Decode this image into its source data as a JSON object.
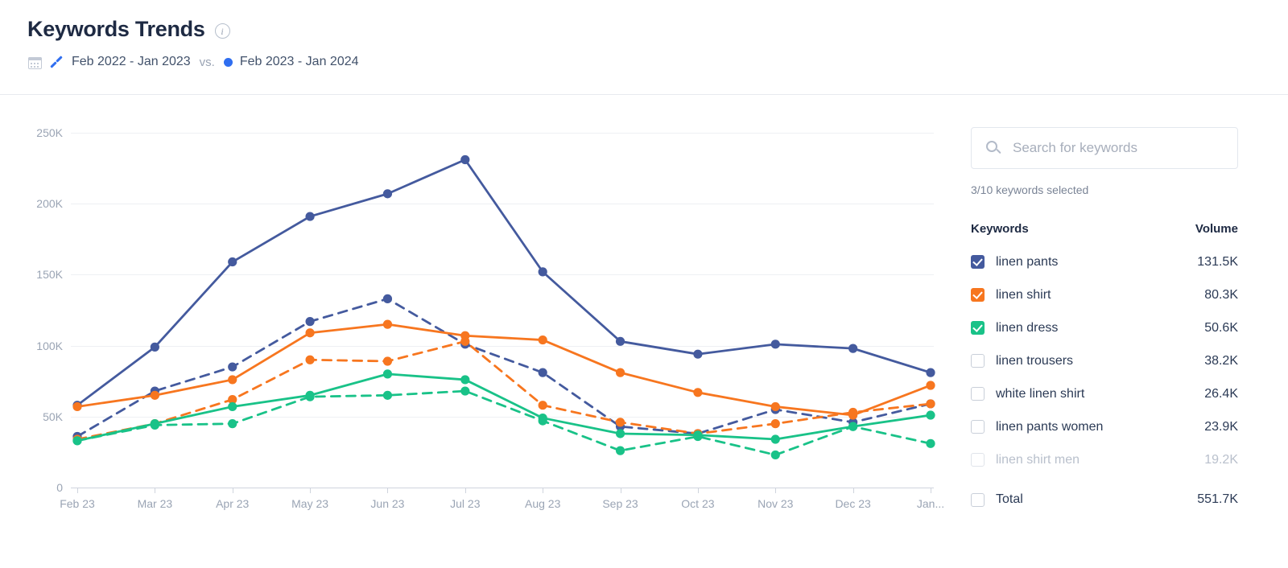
{
  "header": {
    "title": "Keywords Trends",
    "info_icon": "info-icon",
    "calendar_icon": "calendar-icon",
    "previous_range": "Feb 2022 - Jan 2023",
    "vs_label": "vs.",
    "current_range": "Feb 2023 - Jan 2024",
    "previous_marker_color": "#2f6ef0",
    "current_marker_color": "#2f6ef0"
  },
  "sidebar": {
    "search": {
      "placeholder": "Search for keywords",
      "value": "",
      "icon": "search-icon"
    },
    "selected_count": "3/10 keywords selected",
    "columns": {
      "keywords": "Keywords",
      "volume": "Volume"
    },
    "rows": [
      {
        "label": "linen pants",
        "volume": "131.5K",
        "checked": true,
        "color": "#445a9e",
        "disabled": false
      },
      {
        "label": "linen shirt",
        "volume": "80.3K",
        "checked": true,
        "color": "#f7761f",
        "disabled": false
      },
      {
        "label": "linen dress",
        "volume": "50.6K",
        "checked": true,
        "color": "#19c288",
        "disabled": false
      },
      {
        "label": "linen trousers",
        "volume": "38.2K",
        "checked": false,
        "color": "#c9cfd9",
        "disabled": false
      },
      {
        "label": "white linen shirt",
        "volume": "26.4K",
        "checked": false,
        "color": "#c9cfd9",
        "disabled": false
      },
      {
        "label": "linen pants women",
        "volume": "23.9K",
        "checked": false,
        "color": "#c9cfd9",
        "disabled": false
      },
      {
        "label": "linen shirt men",
        "volume": "19.2K",
        "checked": false,
        "color": "#c9cfd9",
        "disabled": true
      }
    ],
    "total": {
      "label": "Total",
      "volume": "551.7K",
      "checked": false
    }
  },
  "chart_data": {
    "type": "line",
    "title": "Keywords Trends",
    "xlabel": "",
    "ylabel": "",
    "ylim": [
      0,
      250000
    ],
    "yticks": [
      0,
      50000,
      100000,
      150000,
      200000,
      250000
    ],
    "ytick_labels": [
      "0",
      "50K",
      "100K",
      "150K",
      "200K",
      "250K"
    ],
    "grid": true,
    "legend_position": "right-panel",
    "categories": [
      "Feb 23",
      "Mar 23",
      "Apr 23",
      "May 23",
      "Jun 23",
      "Jul 23",
      "Aug 23",
      "Sep 23",
      "Oct 23",
      "Nov 23",
      "Dec 23",
      "Jan..."
    ],
    "series": [
      {
        "name": "linen pants",
        "period": "Feb 2023 - Jan 2024",
        "style": "solid",
        "color": "#445a9e",
        "values": [
          58000,
          99000,
          159000,
          191000,
          207000,
          231000,
          152000,
          103000,
          94000,
          101000,
          98000,
          81000
        ]
      },
      {
        "name": "linen pants",
        "period": "Feb 2022 - Jan 2023",
        "style": "dashed",
        "color": "#445a9e",
        "values": [
          36000,
          68000,
          85000,
          117000,
          133000,
          101000,
          81000,
          43000,
          38000,
          55000,
          46000,
          59000
        ]
      },
      {
        "name": "linen shirt",
        "period": "Feb 2023 - Jan 2024",
        "style": "solid",
        "color": "#f7761f",
        "values": [
          57000,
          65000,
          76000,
          109000,
          115000,
          107000,
          104000,
          81000,
          67000,
          57000,
          51000,
          72000
        ]
      },
      {
        "name": "linen shirt",
        "period": "Feb 2022 - Jan 2023",
        "style": "dashed",
        "color": "#f7761f",
        "values": [
          34000,
          45000,
          62000,
          90000,
          89000,
          103000,
          58000,
          46000,
          38000,
          45000,
          53000,
          59000
        ]
      },
      {
        "name": "linen dress",
        "period": "Feb 2023 - Jan 2024",
        "style": "solid",
        "color": "#19c288",
        "values": [
          33000,
          45000,
          57000,
          65000,
          80000,
          76000,
          49000,
          38000,
          37000,
          34000,
          43000,
          51000
        ]
      },
      {
        "name": "linen dress",
        "period": "Feb 2022 - Jan 2023",
        "style": "dashed",
        "color": "#19c288",
        "values": [
          33000,
          44000,
          45000,
          64000,
          65000,
          68000,
          47000,
          26000,
          36000,
          23000,
          43000,
          31000
        ]
      }
    ]
  }
}
